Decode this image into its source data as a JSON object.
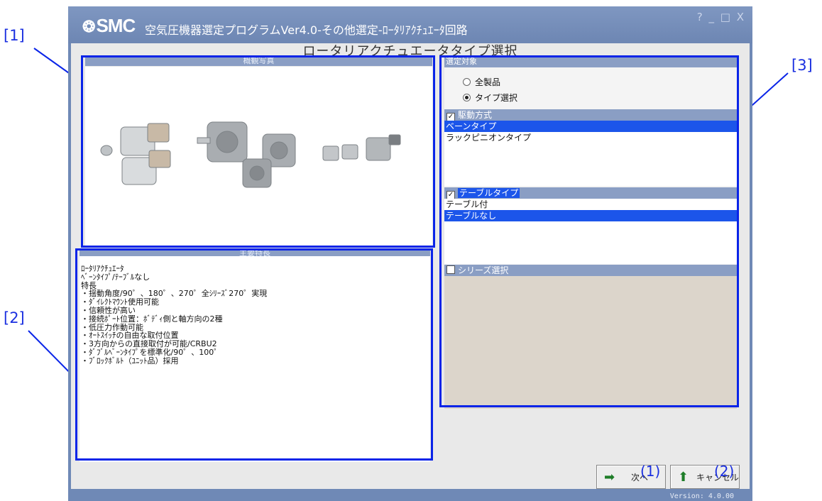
{
  "annotations": {
    "label1": "[1]",
    "label2": "[2]",
    "label3": "[3]",
    "btn_tag1": "(1)",
    "btn_tag2": "(2)"
  },
  "window": {
    "logo": "SMC",
    "title": "空気圧機器選定プログラムVer4.0-その他選定-ﾛｰﾀﾘｱｸﾁｭｴｰﾀ回路",
    "controls": "? _ □ X",
    "screen_title": "ロータリアクチュエータタイプ選択",
    "version": "Version: 4.0.00"
  },
  "photo_panel": {
    "header": "概観写真"
  },
  "features_panel": {
    "header": "主要特長",
    "lines": [
      "ﾛｰﾀﾘｱｸﾁｭｴｰﾀ",
      "ﾍﾞｰﾝﾀｲﾌﾟ/ﾃｰﾌﾞﾙなし",
      "特長",
      "・揺動角度/90゜、180゜、270゜全ｼﾘｰｽﾞ270゜実現",
      "・ﾀﾞｲﾚｸﾄﾏｳﾝﾄ使用可能",
      "・信頼性が高い",
      "・接続ﾎﾟｰﾄ位置：ﾎﾞﾃﾞｨ側と軸方向の2種",
      "・低圧力作動可能",
      "・ｵｰﾄｽｲｯﾁの自由な取付位置",
      "・3方向からの直接取付が可能/CRBU2",
      "・ﾀﾞﾌﾞﾙﾍﾞｰﾝﾀｲﾌﾟを標準化/90゜、100゜",
      "・ﾌﾞﾛｯｸﾎﾞﾙﾄ（ﾕﾆｯﾄ品）採用"
    ]
  },
  "selection_panel": {
    "header": "選定対象",
    "radio_all": "全製品",
    "radio_type": "タイプ選択",
    "drive": {
      "label": "駆動方式",
      "checked": true,
      "options": [
        "ベーンタイプ",
        "ラックピニオンタイプ"
      ],
      "selected_index": 0
    },
    "table": {
      "label": "テーブルタイプ",
      "checked": true,
      "options": [
        "テーブル付",
        "テーブルなし"
      ],
      "selected_index": 1
    },
    "series": {
      "label": "シリーズ選択",
      "checked": false
    }
  },
  "buttons": {
    "next": "次へ",
    "cancel": "キャンセル"
  },
  "colors": {
    "annotation_blue": "#0a24e8",
    "selection_blue": "#1c55ea",
    "panel_header": "#8a9ec4"
  }
}
